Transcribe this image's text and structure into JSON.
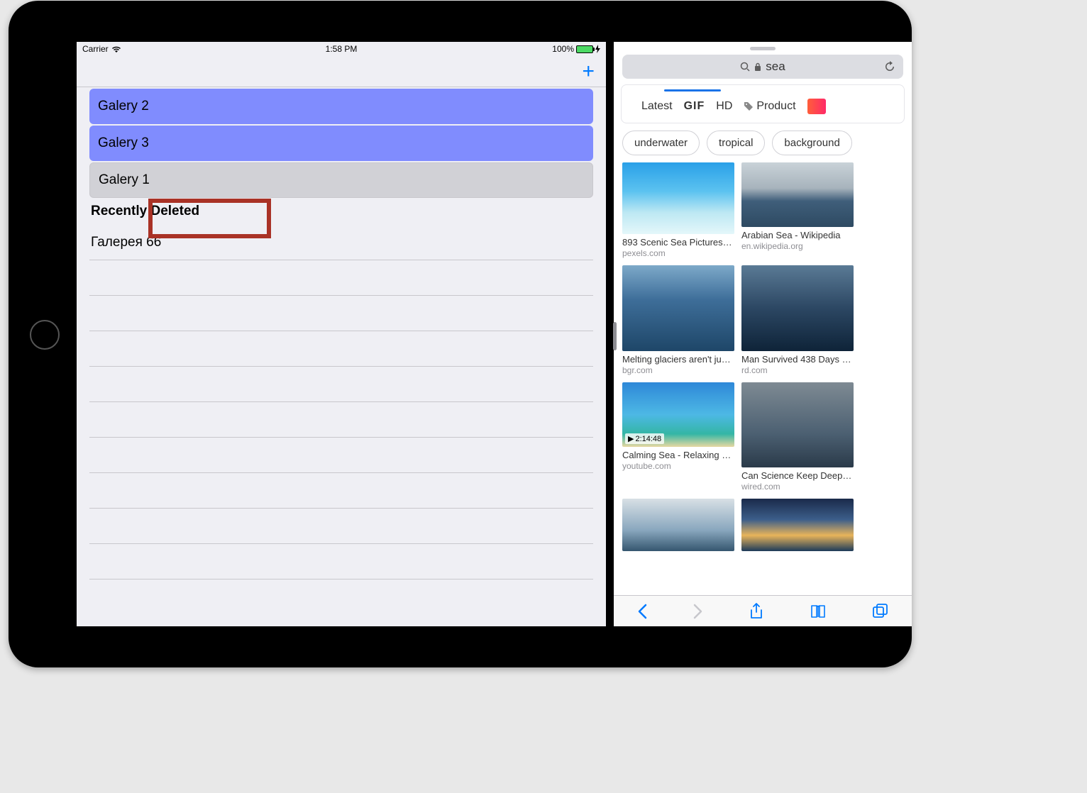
{
  "statusbar": {
    "carrier": "Carrier",
    "time": "1:58 PM",
    "battery_pct": "100%"
  },
  "left_app": {
    "add_label": "+",
    "selected_rows": [
      {
        "label": "Galery 2"
      },
      {
        "label": "Galery 3"
      }
    ],
    "dragged_row": {
      "label": "Galery 1"
    },
    "section_header": "Recently Deleted",
    "section_rows": [
      {
        "label": "Галерея 66"
      }
    ]
  },
  "safari": {
    "url_text": "sea",
    "filter_bar": {
      "latest": "Latest",
      "gif": "GIF",
      "hd": "HD",
      "product": "Product"
    },
    "chips": [
      "underwater",
      "tropical",
      "background"
    ],
    "results": [
      {
        "title": "893 Scenic Sea Pictures · P…",
        "source": "pexels.com",
        "thumb_class": "sky1"
      },
      {
        "title": "Arabian Sea - Wikipedia",
        "source": "en.wikipedia.org",
        "thumb_class": "sea1"
      },
      {
        "title": "Melting glaciers aren't just …",
        "source": "bgr.com",
        "thumb_class": "sea2"
      },
      {
        "title": "Man Survived 438 Days Stu…",
        "source": "rd.com",
        "thumb_class": "sea3"
      },
      {
        "title": "Calming Sea - Relaxing 2 H…",
        "source": "youtube.com",
        "thumb_class": "palm",
        "timestamp": "2:14:48"
      },
      {
        "title": "Can Science Keep Deep Se…",
        "source": "wired.com",
        "thumb_class": "storm"
      },
      {
        "title": "",
        "source": "",
        "thumb_class": "ship"
      },
      {
        "title": "",
        "source": "",
        "thumb_class": "sunset"
      }
    ]
  }
}
